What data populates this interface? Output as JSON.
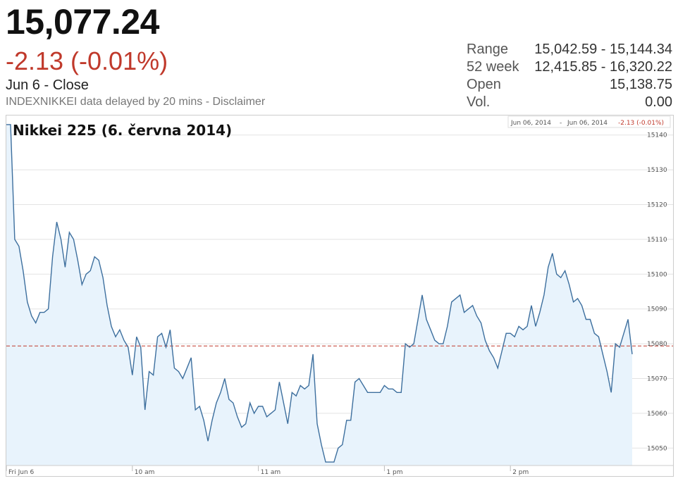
{
  "quote": {
    "price": "15,077.24",
    "change": "-2.13 (-0.01%)",
    "date_status": "Jun 6 - Close",
    "delay_note": "INDEXNIKKEI data delayed by 20 mins - Disclaimer"
  },
  "stats": [
    {
      "label": "Range",
      "value": "15,042.59 - 15,144.34"
    },
    {
      "label": "52 week",
      "value": "12,415.85 - 16,320.22"
    },
    {
      "label": "Open",
      "value": "15,138.75"
    },
    {
      "label": "Vol.",
      "value": "0.00"
    }
  ],
  "legend": {
    "from": "Jun 06, 2014",
    "sep": "-",
    "to": "Jun 06, 2014",
    "change": "-2.13 (-0.01%)"
  },
  "colors": {
    "line": "#3d6f9e",
    "fill": "#e8f3fc",
    "reference": "#c0392b",
    "change": "#c0392b"
  },
  "chart_data": {
    "type": "area",
    "title": "Nikkei 225 (6. června 2014)",
    "x_ticks": [
      {
        "label": "Fri Jun 6",
        "minute": 0
      },
      {
        "label": "10 am",
        "minute": 60
      },
      {
        "label": "11 am",
        "minute": 120
      },
      {
        "label": "1 pm",
        "minute": 180
      },
      {
        "label": "2 pm",
        "minute": 240
      }
    ],
    "x_range": [
      0,
      300
    ],
    "y_ticks": [
      15050,
      15060,
      15070,
      15080,
      15090,
      15100,
      15110,
      15120,
      15130,
      15140
    ],
    "ylim": [
      15045,
      15145
    ],
    "reference_line": 15079.37,
    "grid": true,
    "series": [
      {
        "x": [
          0,
          2,
          4,
          6,
          8,
          10,
          12,
          14,
          16,
          18,
          20,
          22,
          24,
          26,
          28,
          30,
          32,
          34,
          36,
          38,
          40,
          42,
          44,
          46,
          48,
          50,
          52,
          54,
          56,
          58,
          60,
          62,
          64,
          66,
          68,
          70,
          72,
          74,
          76,
          78,
          80,
          82,
          84,
          86,
          88,
          90,
          92,
          94,
          96,
          98,
          100,
          102,
          104,
          106,
          108,
          110,
          112,
          114,
          116,
          118,
          120,
          122,
          124,
          126,
          128,
          130,
          132,
          134,
          136,
          138,
          140,
          142,
          144,
          146,
          148,
          150,
          152,
          154,
          156,
          158,
          160,
          162,
          164,
          166,
          168,
          170,
          172,
          174,
          176,
          178,
          180,
          182,
          184,
          186,
          188,
          190,
          192,
          194,
          196,
          198,
          200,
          202,
          204,
          206,
          208,
          210,
          212,
          214,
          216,
          218,
          220,
          222,
          224,
          226,
          228,
          230,
          232,
          234,
          236,
          238,
          240,
          242,
          244,
          246,
          248,
          250,
          252,
          254,
          256,
          258,
          260,
          262,
          264,
          266,
          268,
          270,
          272,
          274,
          276,
          278,
          280,
          282,
          284,
          286,
          288,
          290,
          292,
          294,
          296,
          298
        ],
        "values": [
          15143,
          15143,
          15110,
          15108,
          15101,
          15092,
          15088,
          15086,
          15089,
          15089,
          15090,
          15105,
          15115,
          15110,
          15102,
          15112,
          15110,
          15104,
          15097,
          15100,
          15101,
          15105,
          15104,
          15099,
          15091,
          15085,
          15082,
          15084,
          15081,
          15079,
          15071,
          15082,
          15079,
          15061,
          15072,
          15071,
          15082,
          15083,
          15079,
          15084,
          15073,
          15072,
          15070,
          15073,
          15076,
          15061,
          15062,
          15058,
          15052,
          15058,
          15063,
          15066,
          15070,
          15064,
          15063,
          15059,
          15056,
          15057,
          15063,
          15060,
          15062,
          15062,
          15059,
          15060,
          15061,
          15069,
          15063,
          15057,
          15066,
          15065,
          15068,
          15067,
          15068,
          15077,
          15057,
          15051,
          15046,
          15046,
          15046,
          15050,
          15051,
          15058,
          15058,
          15069,
          15070,
          15068,
          15066,
          15066,
          15066,
          15066,
          15068,
          15067,
          15067,
          15066,
          15066,
          15080,
          15079,
          15080,
          15087,
          15094,
          15087,
          15084,
          15081,
          15080,
          15080,
          15085,
          15092,
          15093,
          15094,
          15089,
          15090,
          15091,
          15088,
          15086,
          15081,
          15078,
          15076,
          15073,
          15078,
          15083,
          15083,
          15082,
          15085,
          15084,
          15085,
          15091,
          15085,
          15089,
          15094,
          15102,
          15106,
          15100,
          15099,
          15101,
          15097,
          15092,
          15093,
          15091,
          15087,
          15087,
          15083,
          15082,
          15077,
          15072,
          15066,
          15080,
          15079,
          15083,
          15087,
          15077
        ]
      }
    ]
  }
}
